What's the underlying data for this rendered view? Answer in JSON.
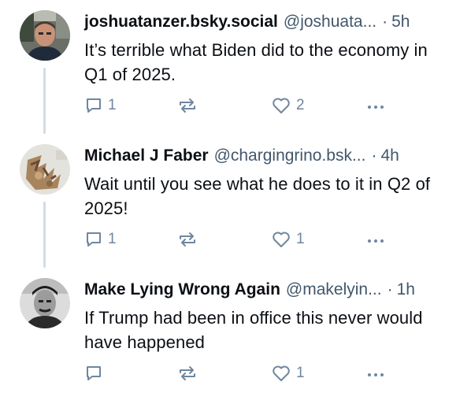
{
  "posts": [
    {
      "author": "joshuatanzer.bsky.social",
      "handle": "@joshuata...",
      "separator": "·",
      "time": "5h",
      "text": "It’s terrible what Biden did to the economy in Q1 of 2025.",
      "reply_count": "1",
      "repost_count": "",
      "like_count": "2"
    },
    {
      "author": "Michael J Faber",
      "handle": "@chargingrino.bsk...",
      "separator": "·",
      "time": "4h",
      "text": "Wait until you see what he does to it in Q2 of 2025!",
      "reply_count": "1",
      "repost_count": "",
      "like_count": "1"
    },
    {
      "author": "Make Lying Wrong Again",
      "handle": "@makelyin...",
      "separator": "·",
      "time": "1h",
      "text": "If Trump had been in office this never would have happened",
      "reply_count": "",
      "repost_count": "",
      "like_count": "1"
    }
  ],
  "icons": {
    "reply": "reply-icon",
    "repost": "repost-icon",
    "like": "heart-icon",
    "more": "more-icon"
  },
  "colors": {
    "text": "#0b0f14",
    "muted": "#42576c",
    "icon": "#6f869f",
    "thread_line": "#d4dbe2"
  }
}
